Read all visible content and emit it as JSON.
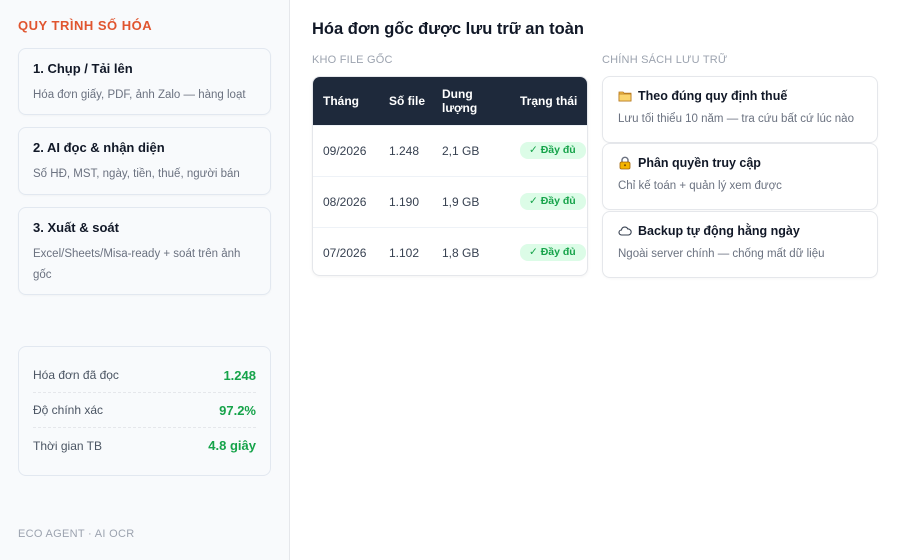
{
  "sidebar": {
    "title": "QUY TRÌNH SỐ HÓA",
    "steps": [
      {
        "title": "1. Chụp / Tải lên",
        "desc": "Hóa đơn giấy, PDF, ảnh Zalo — hàng loạt"
      },
      {
        "title": "2. AI đọc & nhận diện",
        "desc": "Số HĐ, MST, ngày, tiền, thuế, người bán"
      },
      {
        "title": "3. Xuất & soát",
        "desc": "Excel/Sheets/Misa-ready + soát trên ảnh gốc"
      }
    ],
    "stats": [
      {
        "label": "Hóa đơn đã đọc",
        "value": "1.248"
      },
      {
        "label": "Độ chính xác",
        "value": "97.2%"
      },
      {
        "label": "Thời gian TB",
        "value": "4.8 giây"
      }
    ],
    "footer": "ECO AGENT · AI OCR"
  },
  "main": {
    "title": "Hóa đơn gốc được lưu trữ an toàn",
    "storage_label": "KHO FILE GỐC",
    "policy_label": "CHÍNH SÁCH LƯU TRỮ",
    "table": {
      "headers": [
        "Tháng",
        "Số file",
        "Dung lượng",
        "Trạng thái"
      ],
      "rows": [
        {
          "month": "09/2026",
          "files": "1.248",
          "size": "2,1 GB",
          "status": "✓ Đầy đủ"
        },
        {
          "month": "08/2026",
          "files": "1.190",
          "size": "1,9 GB",
          "status": "✓ Đầy đủ"
        },
        {
          "month": "07/2026",
          "files": "1.102",
          "size": "1,8 GB",
          "status": "✓ Đầy đủ"
        }
      ]
    },
    "policies": [
      {
        "icon": "folder-icon",
        "title": "Theo đúng quy định thuế",
        "desc": "Lưu tối thiểu 10 năm — tra cứu bất cứ lúc nào"
      },
      {
        "icon": "lock-icon",
        "title": "Phân quyền truy cập",
        "desc": "Chỉ kế toán + quản lý xem được"
      },
      {
        "icon": "cloud-icon",
        "title": "Backup tự động hằng ngày",
        "desc": "Ngoài server chính — chống mất dữ liệu"
      }
    ]
  },
  "colors": {
    "accent": "#e0552f",
    "success": "#16a34a",
    "table_header": "#1e293b"
  }
}
